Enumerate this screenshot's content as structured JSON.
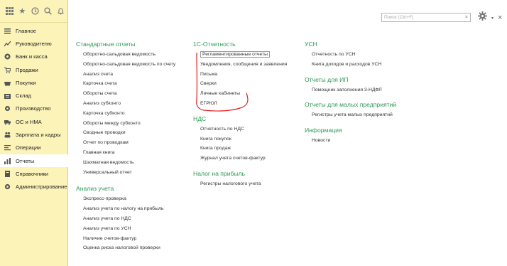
{
  "sidebar": {
    "items": [
      {
        "label": "Главное",
        "icon": "hamburger-icon"
      },
      {
        "label": "Руководителю",
        "icon": "chart-icon"
      },
      {
        "label": "Банк и касса",
        "icon": "coins-icon"
      },
      {
        "label": "Продажи",
        "icon": "cart-icon"
      },
      {
        "label": "Покупки",
        "icon": "basket-icon"
      },
      {
        "label": "Склад",
        "icon": "warehouse-icon"
      },
      {
        "label": "Производство",
        "icon": "gear-icon"
      },
      {
        "label": "ОС и НМА",
        "icon": "truck-icon"
      },
      {
        "label": "Зарплата и кадры",
        "icon": "people-icon"
      },
      {
        "label": "Операции",
        "icon": "operations-icon"
      },
      {
        "label": "Отчеты",
        "icon": "reports-icon"
      },
      {
        "label": "Справочники",
        "icon": "book-icon"
      },
      {
        "label": "Администрирование",
        "icon": "admin-gear-icon"
      }
    ],
    "active_index": 10
  },
  "search": {
    "placeholder": "Поиск (Ctrl+F)",
    "clear": "×"
  },
  "columns": [
    {
      "sections": [
        {
          "title": "Стандартные отчеты",
          "items": [
            "Оборотно-сальдовая ведомость",
            "Оборотно-сальдовая ведомость по счету",
            "Анализ счета",
            "Карточка счета",
            "Обороты счета",
            "Анализ субконто",
            "Карточка субконто",
            "Обороты между субконто",
            "Сводные проводки",
            "Отчет по проводкам",
            "Главная книга",
            "Шахматная ведомость",
            "Универсальный отчет"
          ]
        },
        {
          "title": "Анализ учета",
          "items": [
            "Экспресс-проверка",
            "Анализ учета по налогу на прибыль",
            "Анализ учета по НДС",
            "Анализ учета по УСН",
            "Наличие счетов-фактур",
            "Оценка риска налоговой проверки"
          ]
        }
      ]
    },
    {
      "sections": [
        {
          "title": "1С-Отчетность",
          "items": [
            "Регламентированные отчеты",
            "Уведомления, сообщения и заявления",
            "Письма",
            "Сверки",
            "Личные кабинеты",
            "ЕГРЮЛ"
          ]
        },
        {
          "title": "НДС",
          "items": [
            "Отчетность по НДС",
            "Книга покупок",
            "Книга продаж",
            "Журнал учета счетов-фактур"
          ]
        },
        {
          "title": "Налог на прибыль",
          "items": [
            "Регистры налогового учета"
          ]
        }
      ]
    },
    {
      "sections": [
        {
          "title": "УСН",
          "items": [
            "Отчетность по УСН",
            "Книга доходов и расходов УСН"
          ]
        },
        {
          "title": "Отчеты для ИП",
          "items": [
            "Помощник заполнения 3-НДФЛ"
          ]
        },
        {
          "title": "Отчеты для малых предприятий",
          "items": [
            "Регистры учета малых предприятий"
          ]
        },
        {
          "title": "Информация",
          "items": [
            "Новости"
          ]
        }
      ]
    }
  ],
  "colors": {
    "section": "#2b9b55",
    "sidebar_bg": "#fbf3b8",
    "annotation": "#e02020"
  }
}
